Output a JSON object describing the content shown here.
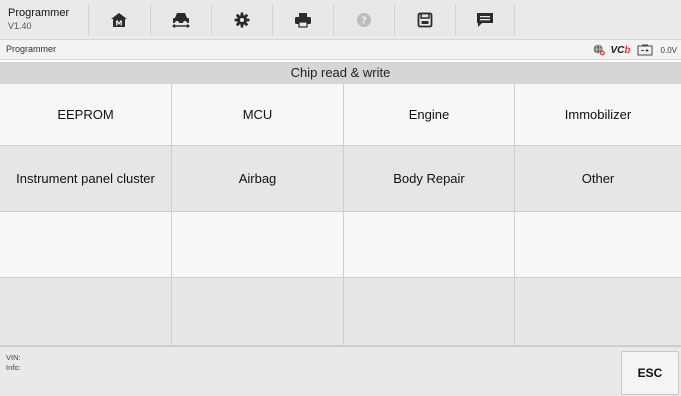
{
  "app": {
    "title": "Programmer",
    "version": "V1.40"
  },
  "toolbar": {
    "buttons": [
      {
        "icon": "home-icon"
      },
      {
        "icon": "vehicle-swap-icon"
      },
      {
        "icon": "gear-icon"
      },
      {
        "icon": "print-icon"
      },
      {
        "icon": "help-icon"
      },
      {
        "icon": "save-icon"
      },
      {
        "icon": "data-log-icon"
      }
    ]
  },
  "status": {
    "breadcrumb": "Programmer",
    "vci_prefix": "VC",
    "vci_suffix": "b",
    "battery": "0.0V"
  },
  "section": {
    "title": "Chip read & write"
  },
  "grid": {
    "cells": [
      "EEPROM",
      "MCU",
      "Engine",
      "Immobilizer",
      "Instrument panel cluster",
      "Airbag",
      "Body Repair",
      "Other",
      "",
      "",
      "",
      "",
      "",
      "",
      "",
      ""
    ]
  },
  "footer": {
    "vin_label": "VIN:",
    "info_label": "Info:",
    "esc_label": "ESC"
  },
  "colors": {
    "accent_red": "#e23b2e",
    "toolbar_bg": "#eaeaea",
    "header_bg": "#d6d6d6"
  }
}
